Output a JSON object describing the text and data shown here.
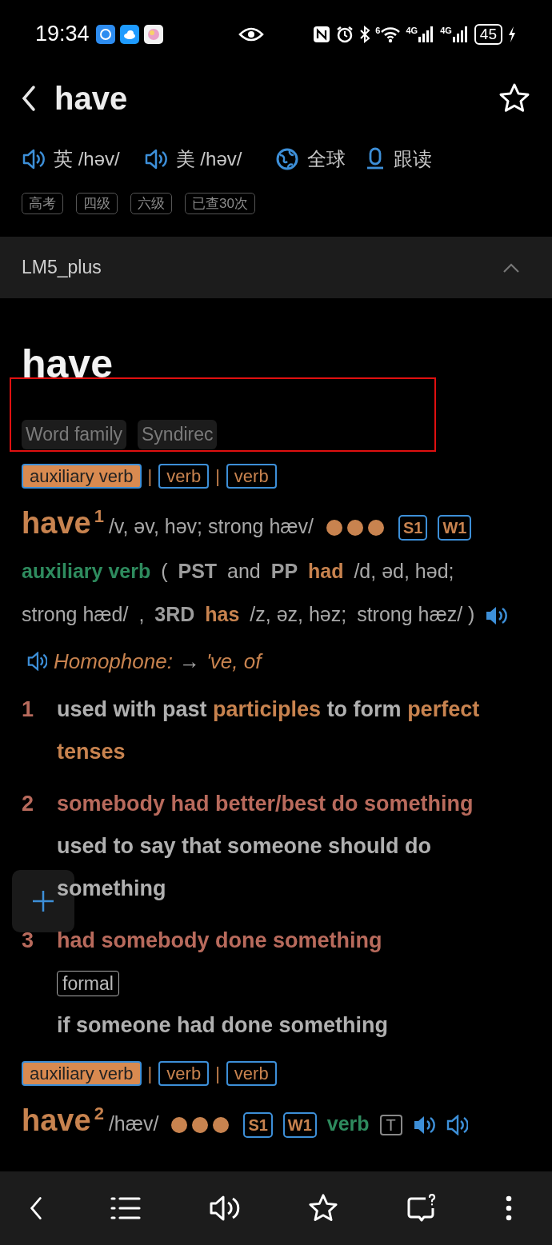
{
  "status_bar": {
    "time": "19:34",
    "wifi_band": "6",
    "networks": [
      "4G",
      "4G"
    ],
    "battery": "45"
  },
  "header": {
    "title": "have"
  },
  "pronunciations": [
    {
      "region": "英",
      "ipa": "/həv/"
    },
    {
      "region": "美",
      "ipa": "/həv/"
    }
  ],
  "actions": [
    {
      "kind": "globe",
      "label": "全球"
    },
    {
      "kind": "mic",
      "label": "跟读"
    }
  ],
  "tags": [
    "高考",
    "四级",
    "六级",
    "已查30次"
  ],
  "section": {
    "title": "LM5_plus",
    "expanded": true
  },
  "word": "have",
  "word_tabs": [
    "Word family",
    "Syndirec"
  ],
  "entries": [
    {
      "separator": "|",
      "pos_tags": [
        {
          "label": "auxiliary verb",
          "selected": true
        },
        {
          "label": "verb",
          "selected": false
        },
        {
          "label": "verb",
          "selected": false
        }
      ],
      "headword": "have",
      "homnum": "1",
      "pron": "/v, əv, həv; strong hæv/",
      "stars": 3,
      "badges": [
        "S1",
        "W1"
      ],
      "pos": "auxiliary verb",
      "grammar": [
        {
          "kind": "plain",
          "text": "("
        },
        {
          "kind": "label",
          "text": "PST"
        },
        {
          "kind": "plain",
          "text": "and"
        },
        {
          "kind": "label",
          "text": "PP"
        },
        {
          "kind": "form",
          "text": "had"
        },
        {
          "kind": "plain",
          "text": "/d, əd, həd;"
        },
        {
          "kind": "plain",
          "text": "strong hæd/"
        },
        {
          "kind": "plain",
          "text": ","
        },
        {
          "kind": "label",
          "text": "3RD"
        },
        {
          "kind": "form",
          "text": "has"
        },
        {
          "kind": "plain",
          "text": "/z, əz, həz;"
        },
        {
          "kind": "plain",
          "text": "strong hæz/ )"
        },
        {
          "kind": "audio-filled"
        }
      ],
      "homophone": {
        "label": "Homophone:",
        "arrow": "→",
        "words": "'ve, of"
      },
      "senses": [
        {
          "number": "1",
          "definition": [
            {
              "text": "used with past",
              "highlight": false
            },
            {
              "text": "participles",
              "highlight": true
            },
            {
              "text": "to form",
              "highlight": false
            },
            {
              "text": "perfect tenses",
              "highlight": true
            }
          ]
        },
        {
          "number": "2",
          "phrase": "somebody had better/best do something",
          "definition": [
            {
              "text": "used to say that someone should do something",
              "highlight": false
            }
          ]
        },
        {
          "number": "3",
          "phrase": "had somebody done something",
          "register": "formal",
          "definition": [
            {
              "text": "if someone had done something",
              "highlight": false
            }
          ]
        }
      ]
    },
    {
      "separator": "|",
      "pos_tags": [
        {
          "label": "auxiliary verb",
          "selected": true
        },
        {
          "label": "verb",
          "selected": false
        },
        {
          "label": "verb",
          "selected": false
        }
      ],
      "headword": "have",
      "homnum": "2",
      "pron": "/hæv/",
      "stars": 3,
      "badges": [
        "S1",
        "W1"
      ],
      "pos": "verb",
      "grammar": [
        {
          "kind": "code",
          "text": "T"
        },
        {
          "kind": "audio-filled"
        },
        {
          "kind": "audio-outline"
        }
      ]
    }
  ]
}
